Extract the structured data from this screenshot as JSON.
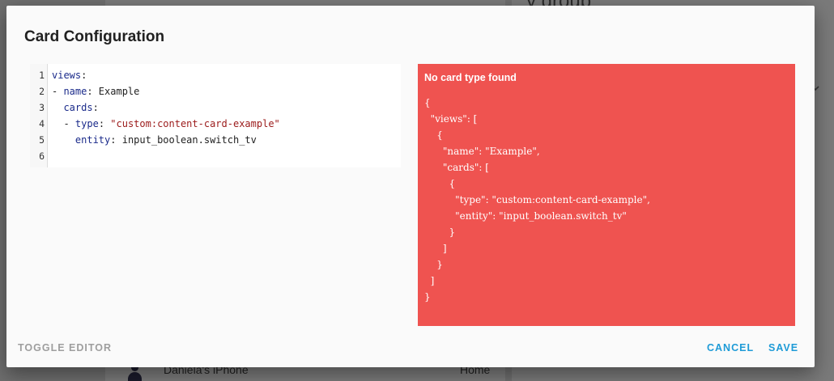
{
  "background": {
    "header_text": "y group",
    "device_name": "Daniela's iPhone",
    "device_area": "Home"
  },
  "dialog": {
    "title": "Card Configuration",
    "editor": {
      "line_numbers": [
        "1",
        "2",
        "3",
        "4",
        "5",
        "6"
      ],
      "lines": [
        [
          {
            "t": "views",
            "c": "key"
          },
          {
            "t": ":",
            "c": ""
          }
        ],
        [
          {
            "t": "- ",
            "c": ""
          },
          {
            "t": "name",
            "c": "key"
          },
          {
            "t": ": Example",
            "c": ""
          }
        ],
        [
          {
            "t": "  ",
            "c": ""
          },
          {
            "t": "cards",
            "c": "key"
          },
          {
            "t": ":",
            "c": ""
          }
        ],
        [
          {
            "t": "  - ",
            "c": ""
          },
          {
            "t": "type",
            "c": "key"
          },
          {
            "t": ": ",
            "c": ""
          },
          {
            "t": "\"custom:content-card-example\"",
            "c": "str"
          }
        ],
        [
          {
            "t": "    ",
            "c": ""
          },
          {
            "t": "entity",
            "c": "key"
          },
          {
            "t": ": input_boolean.switch_tv",
            "c": ""
          }
        ],
        []
      ]
    },
    "error": {
      "title": "No card type found",
      "json_lines": [
        "{",
        "  \"views\": [",
        "    {",
        "      \"name\": \"Example\",",
        "      \"cards\": [",
        "        {",
        "          \"type\": \"custom:content-card-example\",",
        "          \"entity\": \"input_boolean.switch_tv\"",
        "        }",
        "      ]",
        "    }",
        "  ]",
        "}"
      ]
    },
    "buttons": {
      "toggle_editor": "TOGGLE EDITOR",
      "cancel": "CANCEL",
      "save": "SAVE"
    }
  },
  "colors": {
    "accent": "#1e9bd7",
    "error_bg": "#ef5350",
    "yaml_key": "#1a2a8a",
    "yaml_string": "#9b1a1a"
  }
}
